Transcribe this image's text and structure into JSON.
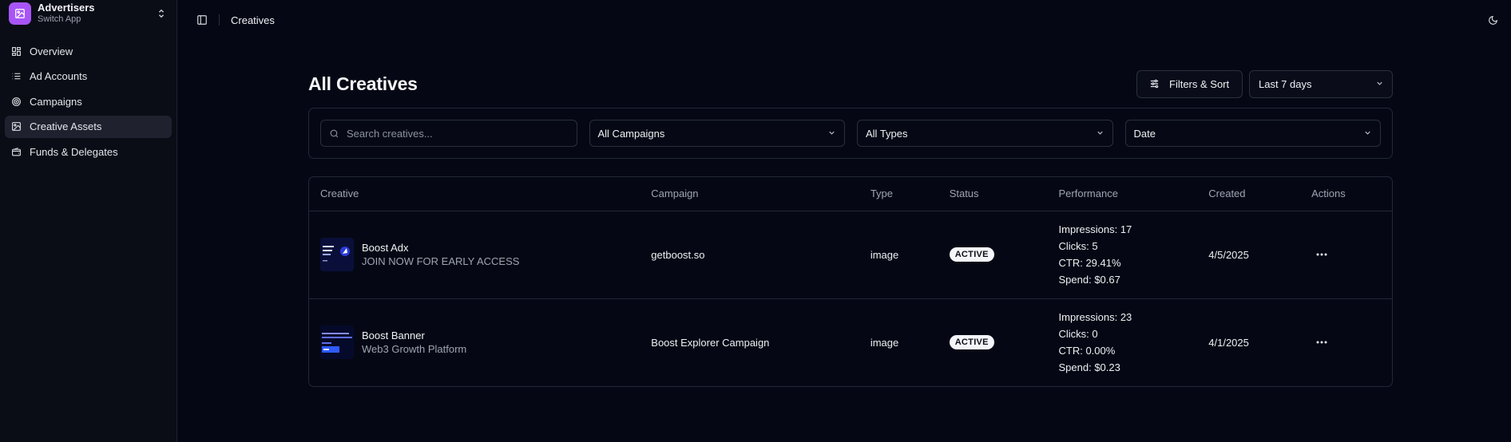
{
  "app_switcher": {
    "title": "Advertisers",
    "subtitle": "Switch App"
  },
  "sidebar": {
    "items": [
      {
        "label": "Overview",
        "icon": "layout-grid-icon",
        "active": false
      },
      {
        "label": "Ad Accounts",
        "icon": "list-icon",
        "active": false
      },
      {
        "label": "Campaigns",
        "icon": "target-icon",
        "active": false
      },
      {
        "label": "Creative Assets",
        "icon": "image-icon",
        "active": true
      },
      {
        "label": "Funds & Delegates",
        "icon": "wallet-icon",
        "active": false
      }
    ]
  },
  "header": {
    "breadcrumb": "Creatives"
  },
  "page": {
    "title": "All Creatives",
    "filters_button": "Filters & Sort",
    "date_range": "Last 7 days"
  },
  "filters": {
    "search_placeholder": "Search creatives...",
    "campaign": "All Campaigns",
    "type": "All Types",
    "sort": "Date"
  },
  "table": {
    "columns": [
      "Creative",
      "Campaign",
      "Type",
      "Status",
      "Performance",
      "Created",
      "Actions"
    ],
    "rows": [
      {
        "name": "Boost Adx",
        "subtitle": "JOIN NOW FOR EARLY ACCESS",
        "campaign": "getboost.so",
        "type": "image",
        "status": "ACTIVE",
        "impressions": "Impressions: 17",
        "clicks": "Clicks: 5",
        "ctr": "CTR: 29.41%",
        "spend": "Spend: $0.67",
        "created": "4/5/2025"
      },
      {
        "name": "Boost Banner",
        "subtitle": "Web3 Growth Platform",
        "campaign": "Boost Explorer Campaign",
        "type": "image",
        "status": "ACTIVE",
        "impressions": "Impressions: 23",
        "clicks": "Clicks: 0",
        "ctr": "CTR: 0.00%",
        "spend": "Spend: $0.23",
        "created": "4/1/2025"
      }
    ]
  },
  "colors": {
    "accent": "#a855f7",
    "background": "#050814",
    "sidebar": "#0b0d16"
  }
}
